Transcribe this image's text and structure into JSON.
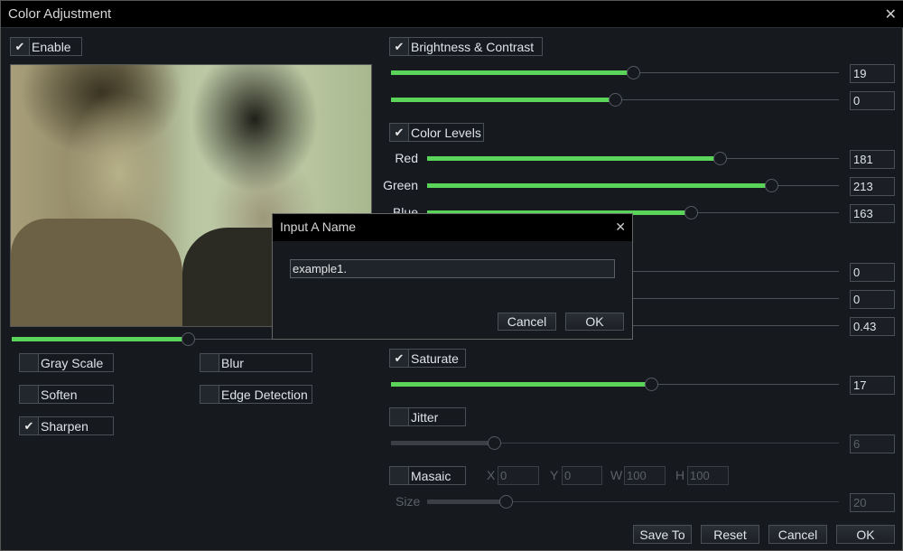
{
  "window": {
    "title": "Color Adjustment",
    "close": "✕"
  },
  "left": {
    "enable": {
      "label": "Enable",
      "checked": true
    },
    "image_slider": {
      "fraction": 0.49
    },
    "effects": [
      {
        "label": "Gray Scale",
        "checked": false
      },
      {
        "label": "Blur",
        "checked": false
      },
      {
        "label": "Soften",
        "checked": false
      },
      {
        "label": "Edge Detection",
        "checked": false
      },
      {
        "label": "Sharpen",
        "checked": true
      }
    ]
  },
  "right": {
    "brightness_contrast": {
      "label": "Brightness & Contrast",
      "checked": true,
      "sliders": [
        {
          "value": "19",
          "fraction": 0.54
        },
        {
          "value": "0",
          "fraction": 0.5
        }
      ]
    },
    "color_levels": {
      "label": "Color Levels",
      "checked": true,
      "sliders": [
        {
          "label": "Red",
          "value": "181",
          "fraction": 0.71
        },
        {
          "label": "Green",
          "value": "213",
          "fraction": 0.835
        },
        {
          "label": "Blue",
          "value": "163",
          "fraction": 0.64
        }
      ]
    },
    "hidden_section": {
      "sliders": [
        {
          "value": "0"
        },
        {
          "value": "0"
        },
        {
          "value": "0.43"
        }
      ]
    },
    "saturate": {
      "label": "Saturate",
      "checked": true,
      "value": "17",
      "fraction": 0.58
    },
    "jitter": {
      "label": "Jitter",
      "checked": false,
      "value": "6",
      "fraction": 0.23
    },
    "masaic": {
      "label": "Masaic",
      "checked": false,
      "x_label": "X",
      "x": "0",
      "y_label": "Y",
      "y": "0",
      "w_label": "W",
      "w": "100",
      "h_label": "H",
      "h": "100",
      "size_label": "Size",
      "size": "20",
      "fraction": 0.19
    }
  },
  "buttons": {
    "save_to": "Save To",
    "reset": "Reset",
    "cancel": "Cancel",
    "ok": "OK"
  },
  "dialog": {
    "title": "Input A Name",
    "close": "✕",
    "input_value": "example1.",
    "cancel": "Cancel",
    "ok": "OK"
  },
  "colors": {
    "accent": "#5ad55a",
    "background": "#16191e",
    "titlebar": "#000000"
  },
  "check_glyph": "✔"
}
